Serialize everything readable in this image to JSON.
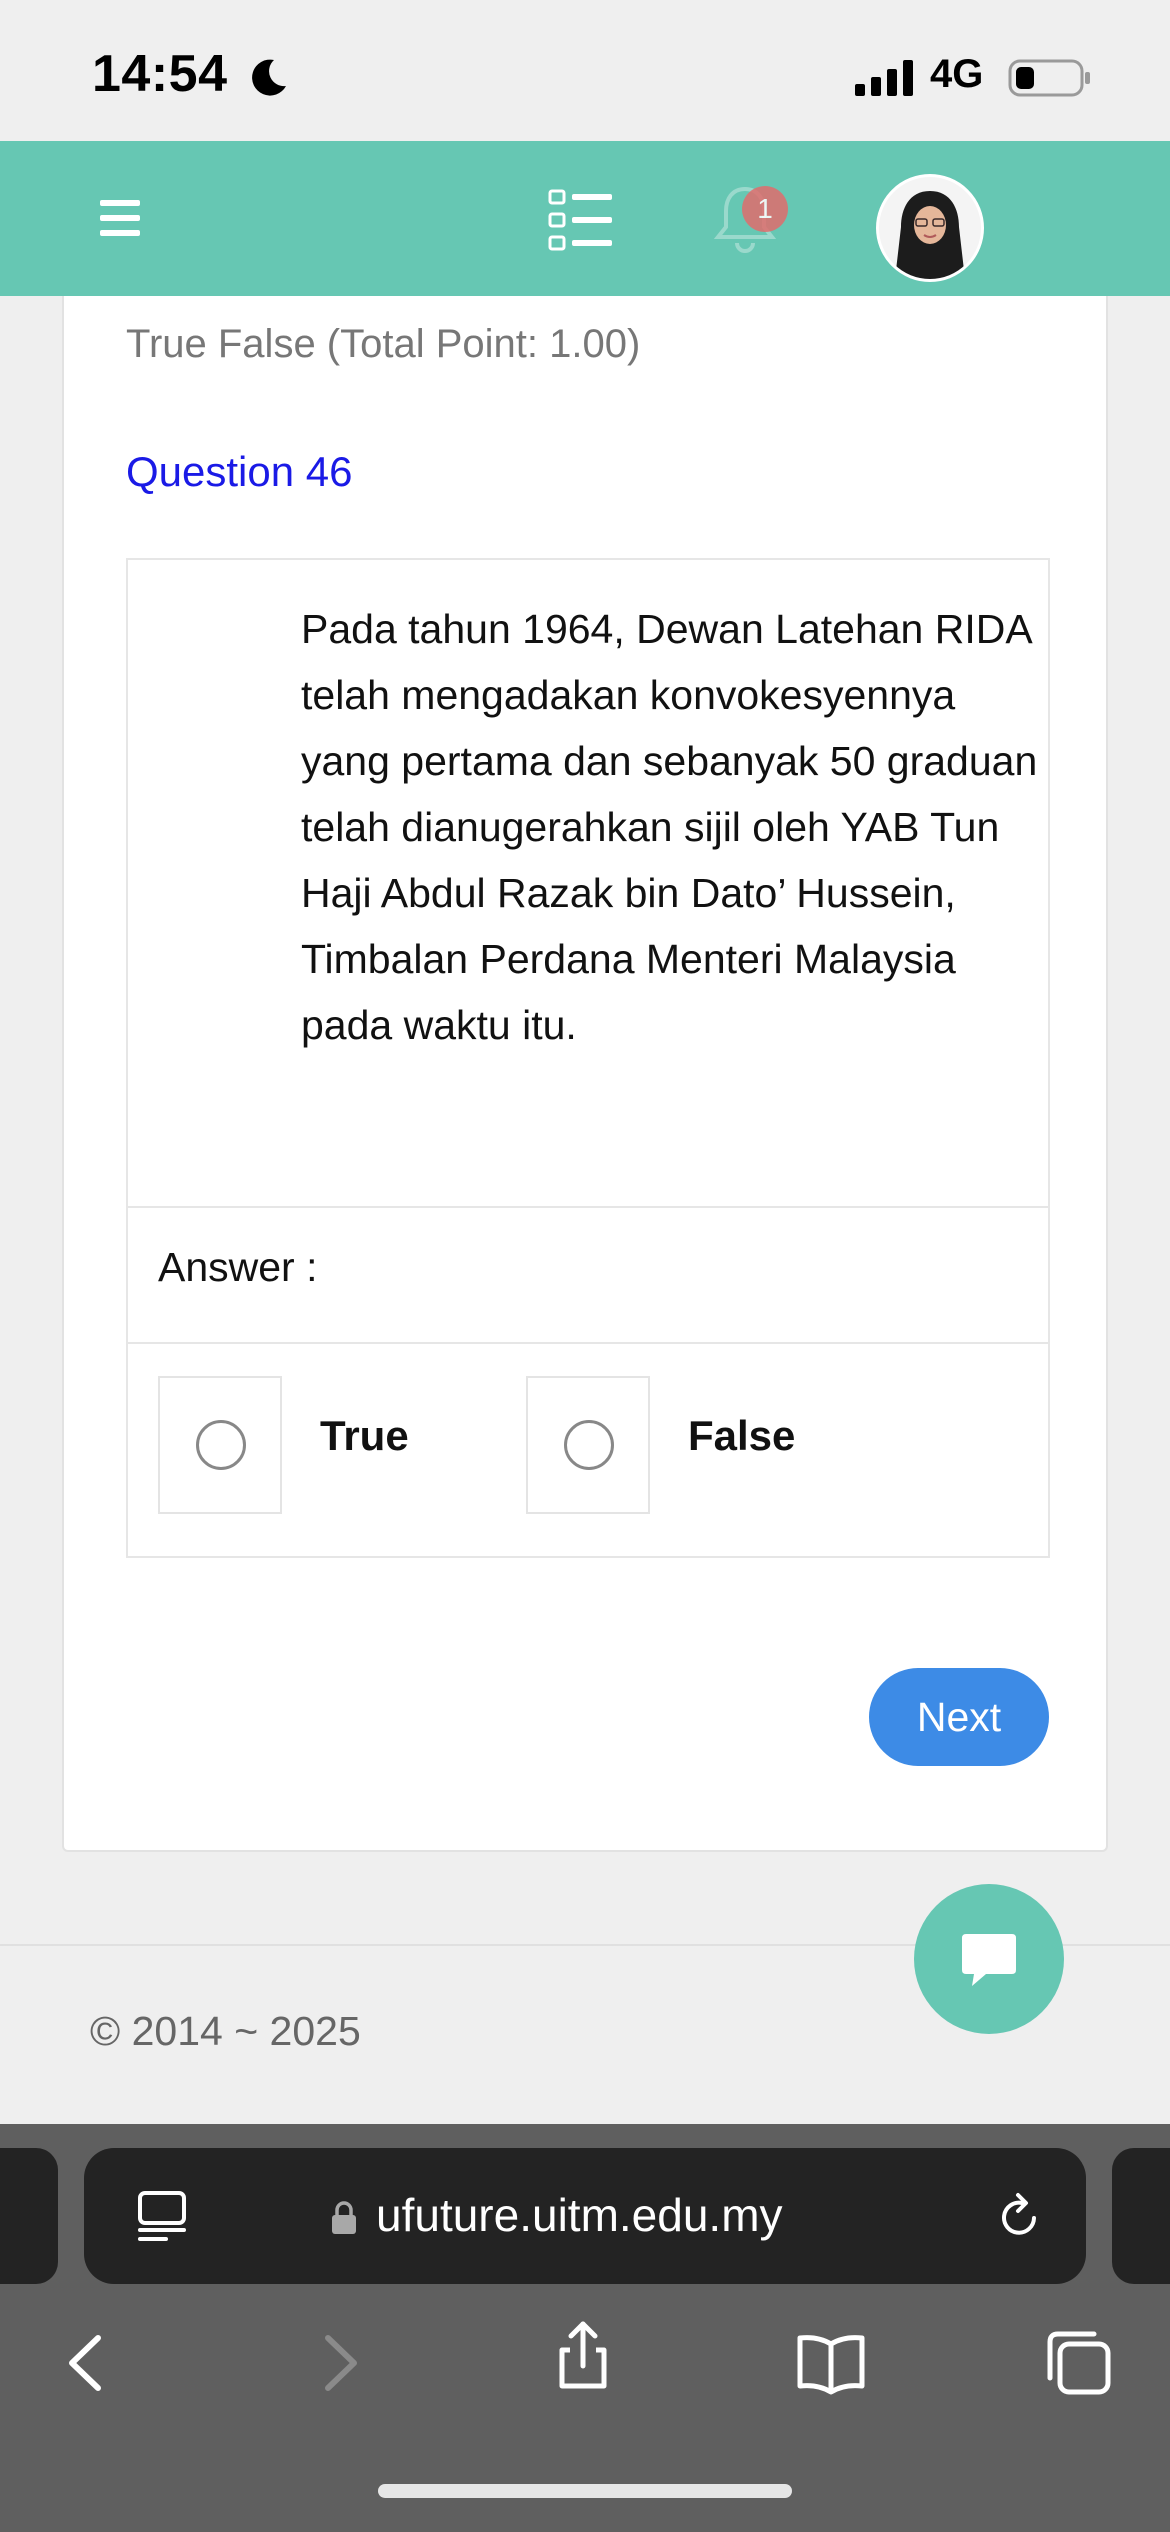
{
  "status_bar": {
    "time": "14:54",
    "network": "4G",
    "icons": [
      "moon-icon",
      "signal-icon",
      "battery-icon"
    ]
  },
  "header": {
    "icons": [
      "menu-icon",
      "list-icon",
      "bell-icon",
      "avatar"
    ],
    "notification_count": "1",
    "colors": {
      "background": "#66c7b3"
    }
  },
  "quiz": {
    "type_label": "True False (Total Point: 1.00)",
    "question_number": "Question 46",
    "question_text": "Pada tahun 1964, Dewan Latehan RIDA telah mengadakan konvokesyennya yang pertama dan sebanyak 50 graduan telah dianugerahkan sijil oleh YAB Tun Haji Abdul Razak bin Dato’ Hussein, Timbalan Perdana Menteri Malaysia pada waktu itu.",
    "answer_label": "Answer :",
    "options": [
      {
        "label": "True",
        "selected": false
      },
      {
        "label": "False",
        "selected": false
      }
    ],
    "next_label": "Next",
    "colors": {
      "question_number": "#1a1ae6",
      "next_button": "#3d8be6"
    }
  },
  "chat": {
    "icon": "chat-icon"
  },
  "footer": {
    "copyright": "© 2014 ~ 2025"
  },
  "browser": {
    "url": "ufuture.uitm.edu.my",
    "icons": [
      "reader-icon",
      "lock-icon",
      "reload-icon",
      "back-icon",
      "forward-icon",
      "share-icon",
      "bookmarks-icon",
      "tabs-icon"
    ]
  }
}
